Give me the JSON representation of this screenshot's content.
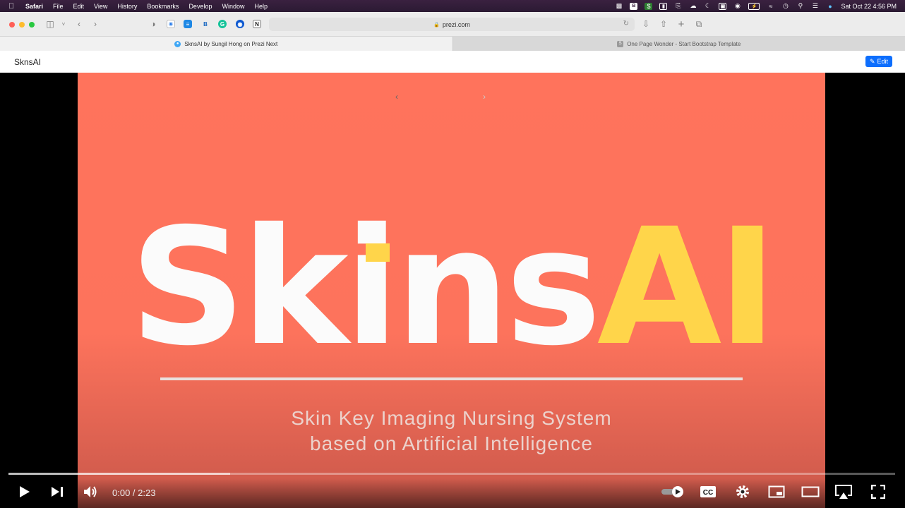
{
  "menubar": {
    "app": "Safari",
    "menus": [
      "File",
      "Edit",
      "View",
      "History",
      "Bookmarks",
      "Develop",
      "Window",
      "Help"
    ],
    "clock": "Sat Oct 22  4:56 PM"
  },
  "toolbar": {
    "address": "prezi.com"
  },
  "tabs": [
    {
      "label": "SknsAI by Sungil Hong on Prezi Next",
      "active": true
    },
    {
      "label": "One Page Wonder - Start Bootstrap Template",
      "active": false
    }
  ],
  "page": {
    "title": "SknsAI",
    "edit_label": "Edit"
  },
  "slide": {
    "logo_white": "Skins",
    "logo_yellow": "AI",
    "subtitle_line1": "Skin Key Imaging Nursing System",
    "subtitle_line2": "based on Artificial Intelligence",
    "bg_color": "#ff735c",
    "accent_color": "#ffd54a"
  },
  "player": {
    "time": "0:00 / 2:23",
    "progress_played": 0.0,
    "progress_buffered": 0.25
  }
}
